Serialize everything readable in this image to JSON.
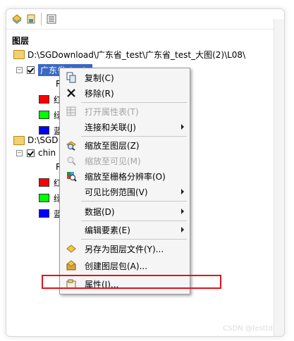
{
  "panel": {
    "title": "图层",
    "toolbar": [
      "list-by-drawing-order-icon",
      "list-by-source-icon",
      "list-by-visibility-icon",
      "options-icon"
    ]
  },
  "tree": {
    "folder1_path": "D:\\SGDownload\\广东省_test\\广东省_test_大图(2)\\L08\\",
    "layer1_name": "广东省_test_",
    "layer1_sub": "R",
    "layer1_bands": [
      {
        "label": "红",
        "color": "#ff0000"
      },
      {
        "label": "绿",
        "color": "#00ff00"
      },
      {
        "label": "蓝",
        "color": "#0000ff"
      }
    ],
    "folder2_path": "D:\\SGD",
    "layer2_name": "chin",
    "layer2_sub": "R",
    "layer2_bands": [
      {
        "label": "红",
        "color": "#ff0000"
      },
      {
        "label": "绿",
        "color": "#00ff00"
      },
      {
        "label": "蓝",
        "color": "#0000ff"
      }
    ]
  },
  "menu": {
    "copy": "复制(C)",
    "remove": "移除(R)",
    "open_attr": "打开属性表(T)",
    "joins": "连接和关联(J)",
    "zoom_layer": "缩放至图层(Z)",
    "zoom_visible": "缩放至可见(M)",
    "zoom_raster": "缩放至栅格分辨率(O)",
    "visible_scale": "可见比例范围(V)",
    "data": "数据(D)",
    "edit_features": "编辑要素(E)",
    "save_layer": "另存为图层文件(Y)...",
    "create_package": "创建图层包(A)...",
    "properties": "属性(I)..."
  },
  "watermark": "CSDN @festtd"
}
